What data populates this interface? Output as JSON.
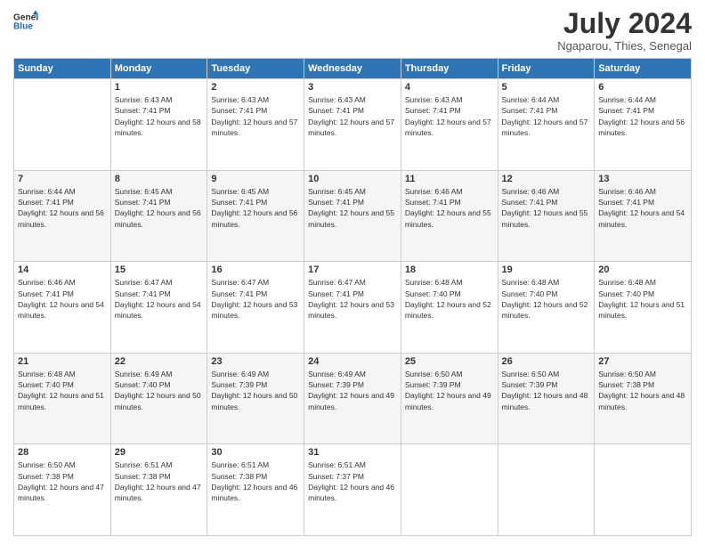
{
  "header": {
    "logo_line1": "General",
    "logo_line2": "Blue",
    "month_title": "July 2024",
    "location": "Ngaparou, Thies, Senegal"
  },
  "days_of_week": [
    "Sunday",
    "Monday",
    "Tuesday",
    "Wednesday",
    "Thursday",
    "Friday",
    "Saturday"
  ],
  "weeks": [
    [
      {
        "day": "",
        "sunrise": "",
        "sunset": "",
        "daylight": ""
      },
      {
        "day": "1",
        "sunrise": "Sunrise: 6:43 AM",
        "sunset": "Sunset: 7:41 PM",
        "daylight": "Daylight: 12 hours and 58 minutes."
      },
      {
        "day": "2",
        "sunrise": "Sunrise: 6:43 AM",
        "sunset": "Sunset: 7:41 PM",
        "daylight": "Daylight: 12 hours and 57 minutes."
      },
      {
        "day": "3",
        "sunrise": "Sunrise: 6:43 AM",
        "sunset": "Sunset: 7:41 PM",
        "daylight": "Daylight: 12 hours and 57 minutes."
      },
      {
        "day": "4",
        "sunrise": "Sunrise: 6:43 AM",
        "sunset": "Sunset: 7:41 PM",
        "daylight": "Daylight: 12 hours and 57 minutes."
      },
      {
        "day": "5",
        "sunrise": "Sunrise: 6:44 AM",
        "sunset": "Sunset: 7:41 PM",
        "daylight": "Daylight: 12 hours and 57 minutes."
      },
      {
        "day": "6",
        "sunrise": "Sunrise: 6:44 AM",
        "sunset": "Sunset: 7:41 PM",
        "daylight": "Daylight: 12 hours and 56 minutes."
      }
    ],
    [
      {
        "day": "7",
        "sunrise": "Sunrise: 6:44 AM",
        "sunset": "Sunset: 7:41 PM",
        "daylight": "Daylight: 12 hours and 56 minutes."
      },
      {
        "day": "8",
        "sunrise": "Sunrise: 6:45 AM",
        "sunset": "Sunset: 7:41 PM",
        "daylight": "Daylight: 12 hours and 56 minutes."
      },
      {
        "day": "9",
        "sunrise": "Sunrise: 6:45 AM",
        "sunset": "Sunset: 7:41 PM",
        "daylight": "Daylight: 12 hours and 56 minutes."
      },
      {
        "day": "10",
        "sunrise": "Sunrise: 6:45 AM",
        "sunset": "Sunset: 7:41 PM",
        "daylight": "Daylight: 12 hours and 55 minutes."
      },
      {
        "day": "11",
        "sunrise": "Sunrise: 6:46 AM",
        "sunset": "Sunset: 7:41 PM",
        "daylight": "Daylight: 12 hours and 55 minutes."
      },
      {
        "day": "12",
        "sunrise": "Sunrise: 6:46 AM",
        "sunset": "Sunset: 7:41 PM",
        "daylight": "Daylight: 12 hours and 55 minutes."
      },
      {
        "day": "13",
        "sunrise": "Sunrise: 6:46 AM",
        "sunset": "Sunset: 7:41 PM",
        "daylight": "Daylight: 12 hours and 54 minutes."
      }
    ],
    [
      {
        "day": "14",
        "sunrise": "Sunrise: 6:46 AM",
        "sunset": "Sunset: 7:41 PM",
        "daylight": "Daylight: 12 hours and 54 minutes."
      },
      {
        "day": "15",
        "sunrise": "Sunrise: 6:47 AM",
        "sunset": "Sunset: 7:41 PM",
        "daylight": "Daylight: 12 hours and 54 minutes."
      },
      {
        "day": "16",
        "sunrise": "Sunrise: 6:47 AM",
        "sunset": "Sunset: 7:41 PM",
        "daylight": "Daylight: 12 hours and 53 minutes."
      },
      {
        "day": "17",
        "sunrise": "Sunrise: 6:47 AM",
        "sunset": "Sunset: 7:41 PM",
        "daylight": "Daylight: 12 hours and 53 minutes."
      },
      {
        "day": "18",
        "sunrise": "Sunrise: 6:48 AM",
        "sunset": "Sunset: 7:40 PM",
        "daylight": "Daylight: 12 hours and 52 minutes."
      },
      {
        "day": "19",
        "sunrise": "Sunrise: 6:48 AM",
        "sunset": "Sunset: 7:40 PM",
        "daylight": "Daylight: 12 hours and 52 minutes."
      },
      {
        "day": "20",
        "sunrise": "Sunrise: 6:48 AM",
        "sunset": "Sunset: 7:40 PM",
        "daylight": "Daylight: 12 hours and 51 minutes."
      }
    ],
    [
      {
        "day": "21",
        "sunrise": "Sunrise: 6:48 AM",
        "sunset": "Sunset: 7:40 PM",
        "daylight": "Daylight: 12 hours and 51 minutes."
      },
      {
        "day": "22",
        "sunrise": "Sunrise: 6:49 AM",
        "sunset": "Sunset: 7:40 PM",
        "daylight": "Daylight: 12 hours and 50 minutes."
      },
      {
        "day": "23",
        "sunrise": "Sunrise: 6:49 AM",
        "sunset": "Sunset: 7:39 PM",
        "daylight": "Daylight: 12 hours and 50 minutes."
      },
      {
        "day": "24",
        "sunrise": "Sunrise: 6:49 AM",
        "sunset": "Sunset: 7:39 PM",
        "daylight": "Daylight: 12 hours and 49 minutes."
      },
      {
        "day": "25",
        "sunrise": "Sunrise: 6:50 AM",
        "sunset": "Sunset: 7:39 PM",
        "daylight": "Daylight: 12 hours and 49 minutes."
      },
      {
        "day": "26",
        "sunrise": "Sunrise: 6:50 AM",
        "sunset": "Sunset: 7:39 PM",
        "daylight": "Daylight: 12 hours and 48 minutes."
      },
      {
        "day": "27",
        "sunrise": "Sunrise: 6:50 AM",
        "sunset": "Sunset: 7:38 PM",
        "daylight": "Daylight: 12 hours and 48 minutes."
      }
    ],
    [
      {
        "day": "28",
        "sunrise": "Sunrise: 6:50 AM",
        "sunset": "Sunset: 7:38 PM",
        "daylight": "Daylight: 12 hours and 47 minutes."
      },
      {
        "day": "29",
        "sunrise": "Sunrise: 6:51 AM",
        "sunset": "Sunset: 7:38 PM",
        "daylight": "Daylight: 12 hours and 47 minutes."
      },
      {
        "day": "30",
        "sunrise": "Sunrise: 6:51 AM",
        "sunset": "Sunset: 7:38 PM",
        "daylight": "Daylight: 12 hours and 46 minutes."
      },
      {
        "day": "31",
        "sunrise": "Sunrise: 6:51 AM",
        "sunset": "Sunset: 7:37 PM",
        "daylight": "Daylight: 12 hours and 46 minutes."
      },
      {
        "day": "",
        "sunrise": "",
        "sunset": "",
        "daylight": ""
      },
      {
        "day": "",
        "sunrise": "",
        "sunset": "",
        "daylight": ""
      },
      {
        "day": "",
        "sunrise": "",
        "sunset": "",
        "daylight": ""
      }
    ]
  ]
}
